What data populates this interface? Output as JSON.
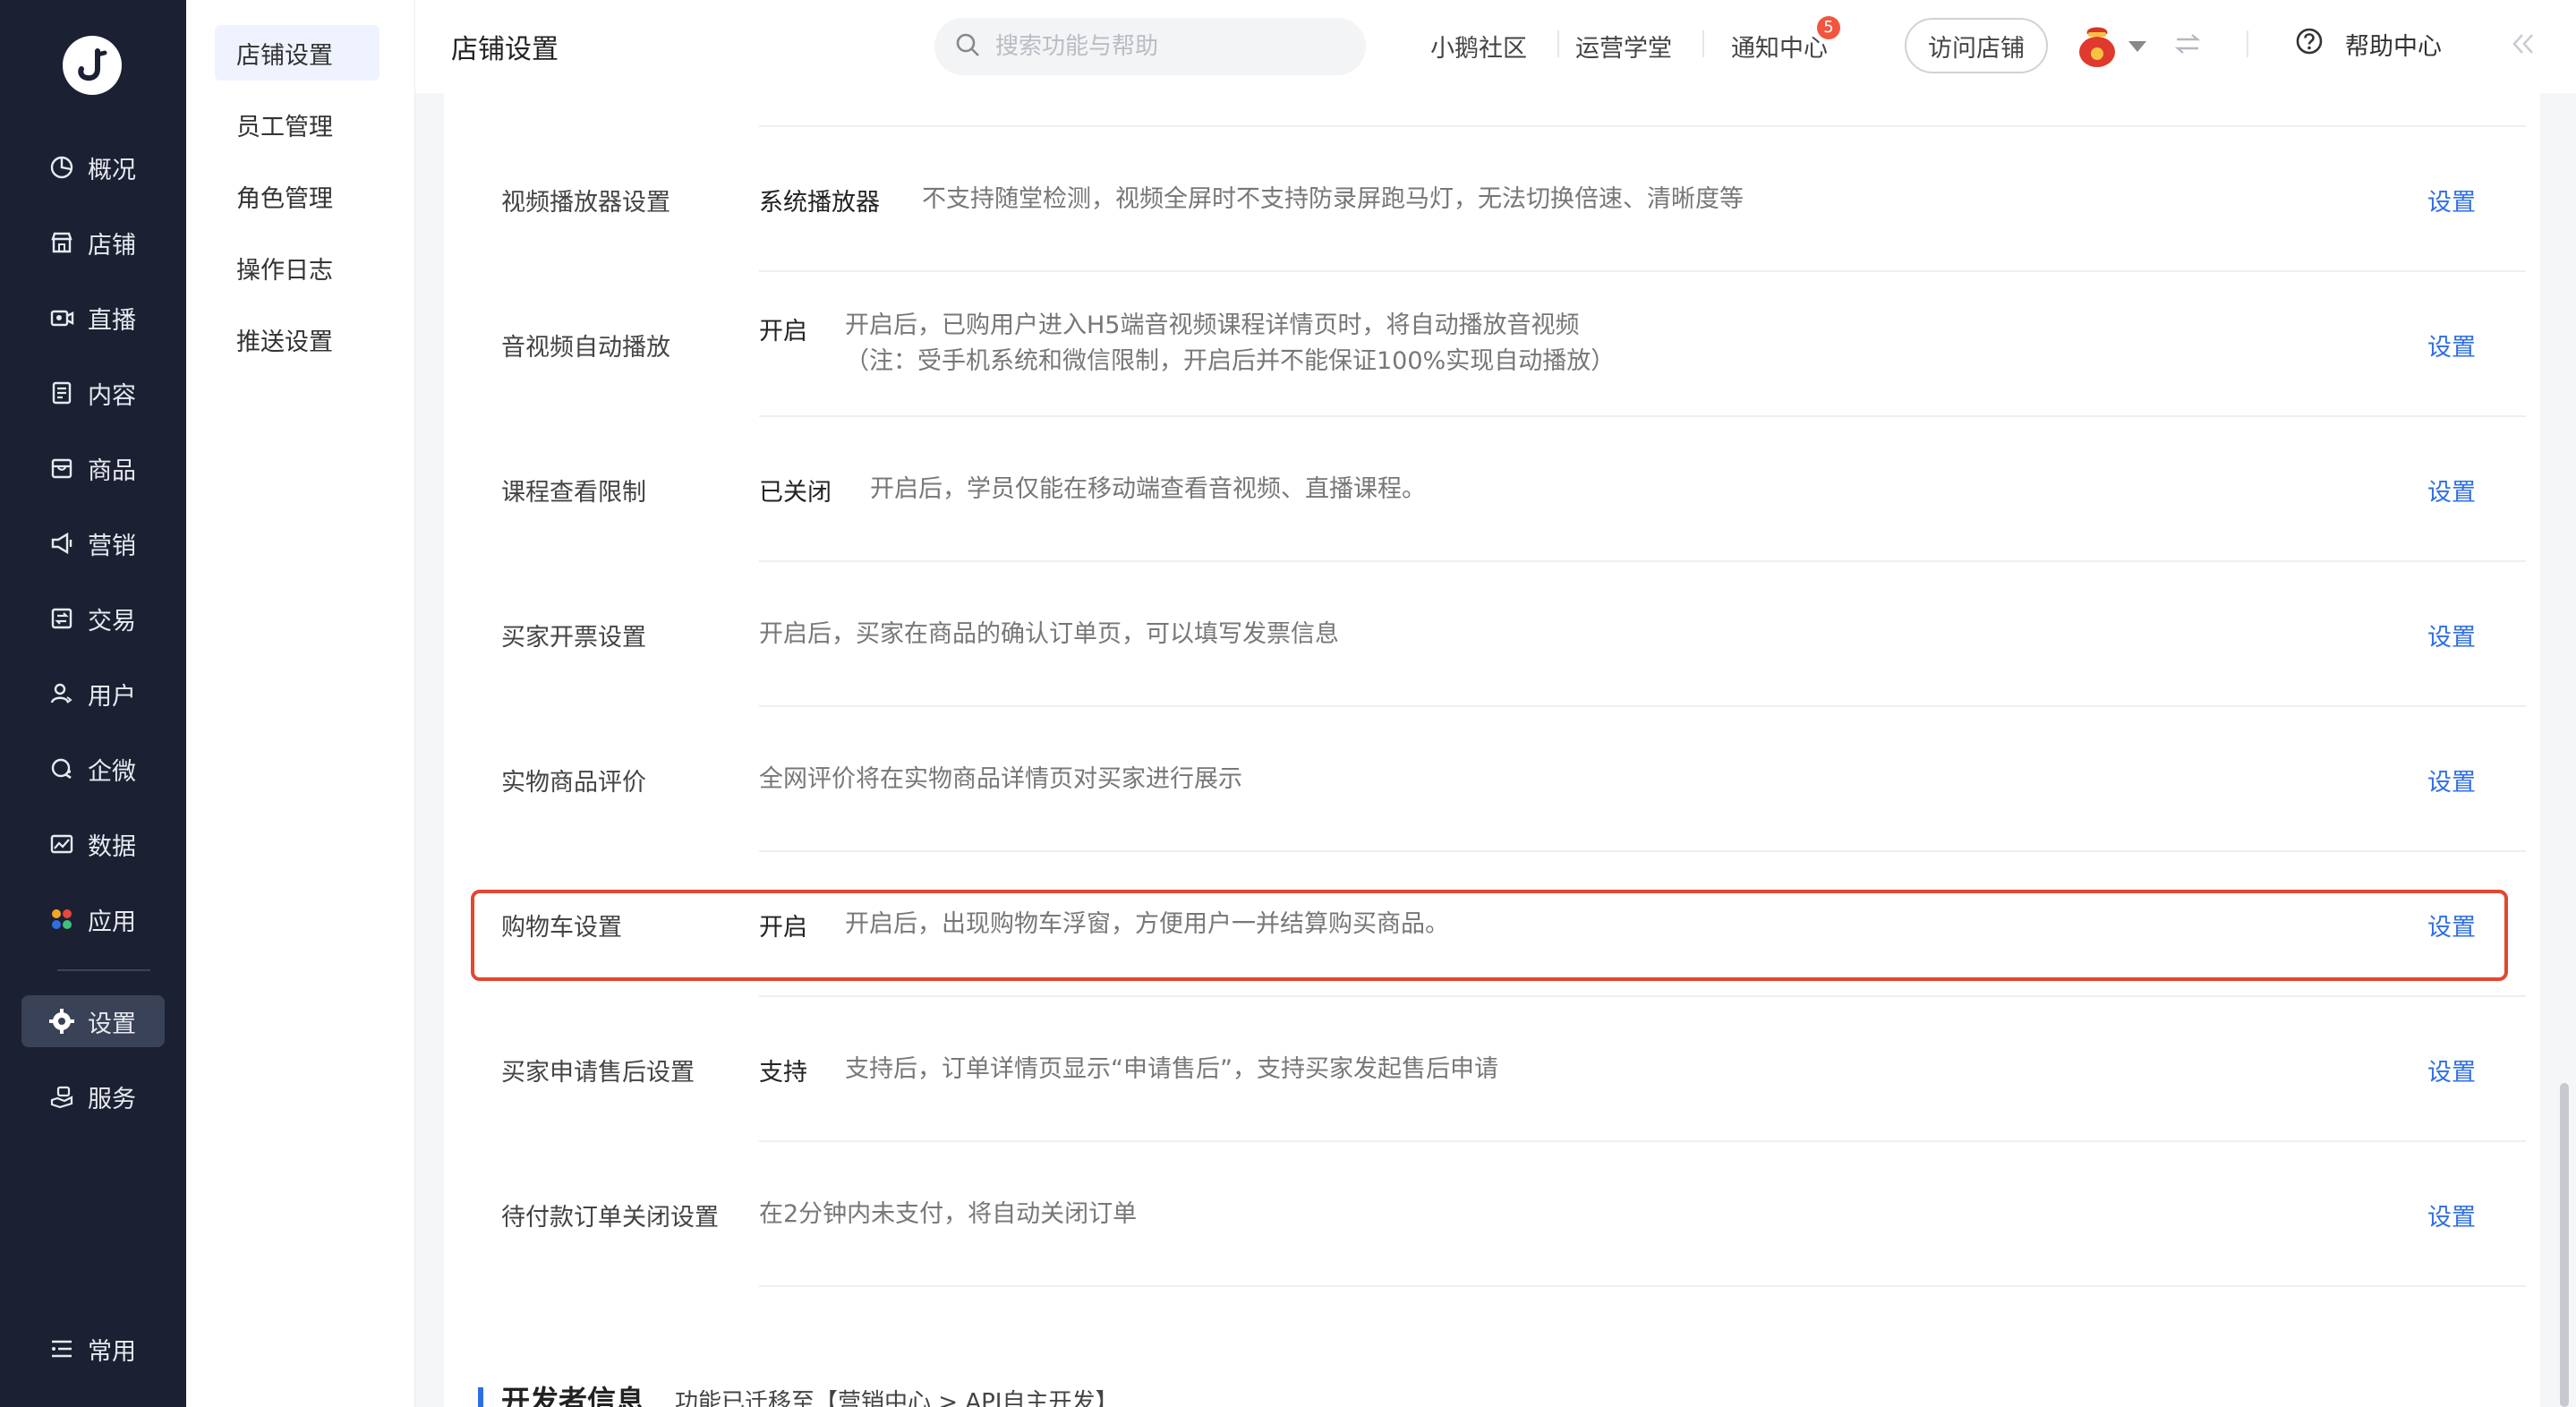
{
  "nav": {
    "items": [
      {
        "label": "概况",
        "icon": "overview-icon"
      },
      {
        "label": "店铺",
        "icon": "shop-icon"
      },
      {
        "label": "直播",
        "icon": "live-icon"
      },
      {
        "label": "内容",
        "icon": "content-icon"
      },
      {
        "label": "商品",
        "icon": "goods-icon"
      },
      {
        "label": "营销",
        "icon": "marketing-icon"
      },
      {
        "label": "交易",
        "icon": "trade-icon"
      },
      {
        "label": "用户",
        "icon": "user-icon"
      },
      {
        "label": "企微",
        "icon": "wecom-icon"
      },
      {
        "label": "数据",
        "icon": "data-icon"
      },
      {
        "label": "应用",
        "icon": "apps-icon"
      },
      {
        "label": "设置",
        "icon": "gear-icon",
        "active": true
      },
      {
        "label": "服务",
        "icon": "service-icon"
      }
    ],
    "common": "常用"
  },
  "submenu": {
    "items": [
      "店铺设置",
      "员工管理",
      "角色管理",
      "操作日志",
      "推送设置"
    ],
    "active_index": 0
  },
  "header": {
    "title": "店铺设置",
    "search_placeholder": "搜索功能与帮助",
    "links": [
      "小鹅社区",
      "运营学堂",
      "通知中心"
    ],
    "notification_count": "5",
    "visit_store": "访问店铺",
    "help": "帮助中心"
  },
  "settings": [
    {
      "label": "视频播放器设置",
      "status": "系统播放器",
      "desc": "不支持随堂检测，视频全屏时不支持防录屏跑马灯，无法切换倍速、清晰度等",
      "action": "设置"
    },
    {
      "label": "音视频自动播放",
      "status": "开启",
      "desc": "开启后，已购用户进入H5端音视频课程详情页时，将自动播放音视频",
      "desc2": "（注：受手机系统和微信限制，开启后并不能保证100%实现自动播放）",
      "action": "设置"
    },
    {
      "label": "课程查看限制",
      "status": "已关闭",
      "desc": "开启后，学员仅能在移动端查看音视频、直播课程。",
      "action": "设置"
    },
    {
      "label": "买家开票设置",
      "status": "",
      "desc": "开启后，买家在商品的确认订单页，可以填写发票信息",
      "action": "设置"
    },
    {
      "label": "实物商品评价",
      "status": "",
      "desc": "全网评价将在实物商品详情页对买家进行展示",
      "action": "设置"
    },
    {
      "label": "购物车设置",
      "status": "开启",
      "desc": "开启后，出现购物车浮窗，方便用户一并结算购买商品。",
      "action": "设置"
    },
    {
      "label": "买家申请售后设置",
      "status": "支持",
      "desc": "支持后，订单详情页显示“申请售后”，支持买家发起售后申请",
      "action": "设置"
    },
    {
      "label": "待付款订单关闭设置",
      "status": "",
      "desc": "在2分钟内未支付，将自动关闭订单",
      "action": "设置"
    }
  ],
  "developer": {
    "title": "开发者信息",
    "note": "功能已迁移至【营销中心 > API自主开发】"
  },
  "colors": {
    "nav_bg": "#1b2133",
    "link_blue": "#2f6fe6",
    "highlight_red": "#e2472f"
  }
}
